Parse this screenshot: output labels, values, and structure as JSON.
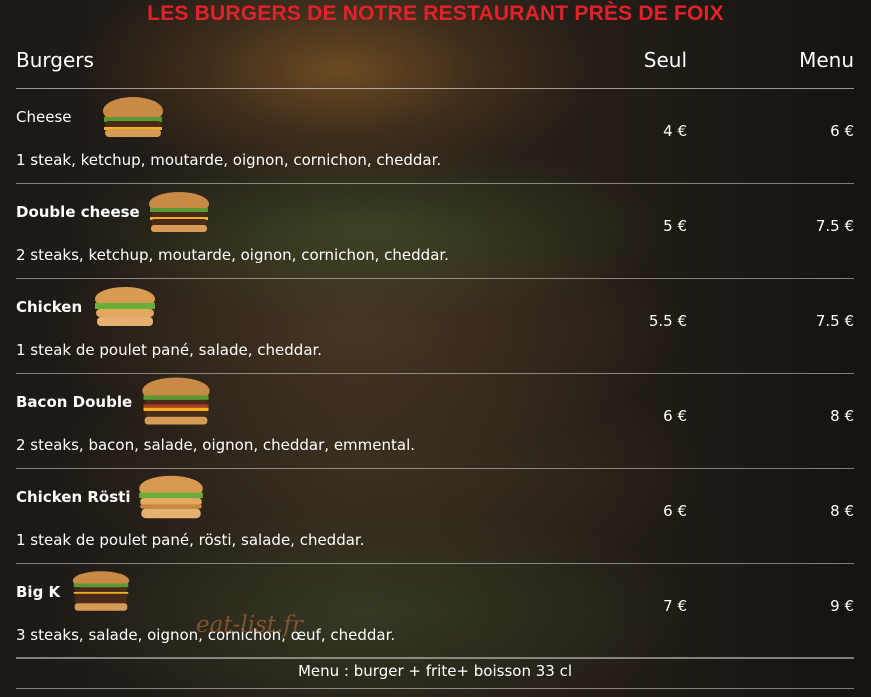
{
  "title": "LES BURGERS DE NOTRE RESTAURANT PRÈS DE FOIX",
  "header": {
    "name": "Burgers",
    "seul": "Seul",
    "menu": "Menu"
  },
  "items": [
    {
      "name": "Cheese",
      "desc": "1 steak, ketchup, moutarde, oignon, cornichon, cheddar.",
      "seul": "4 €",
      "menu": "6 €"
    },
    {
      "name": "Double cheese",
      "desc": "2 steaks, ketchup, moutarde, oignon, cornichon, cheddar.",
      "seul": "5 €",
      "menu": "7.5 €"
    },
    {
      "name": "Chicken",
      "desc": "1 steak de poulet pané, salade, cheddar.",
      "seul": "5.5 €",
      "menu": "7.5 €"
    },
    {
      "name": "Bacon Double",
      "desc": "2 steaks, bacon, salade, oignon, cheddar, emmental.",
      "seul": "6 €",
      "menu": "8 €"
    },
    {
      "name": "Chicken Rösti",
      "desc": "1 steak de poulet pané, rösti, salade, cheddar.",
      "seul": "6 €",
      "menu": "8 €"
    },
    {
      "name": "Big K",
      "desc": "3 steaks, salade, oignon, cornichon, œuf, cheddar.",
      "seul": "7 €",
      "menu": "9 €"
    }
  ],
  "footer": "Menu : burger + frite+ boisson 33 cl",
  "watermark": "eat-list.fr"
}
